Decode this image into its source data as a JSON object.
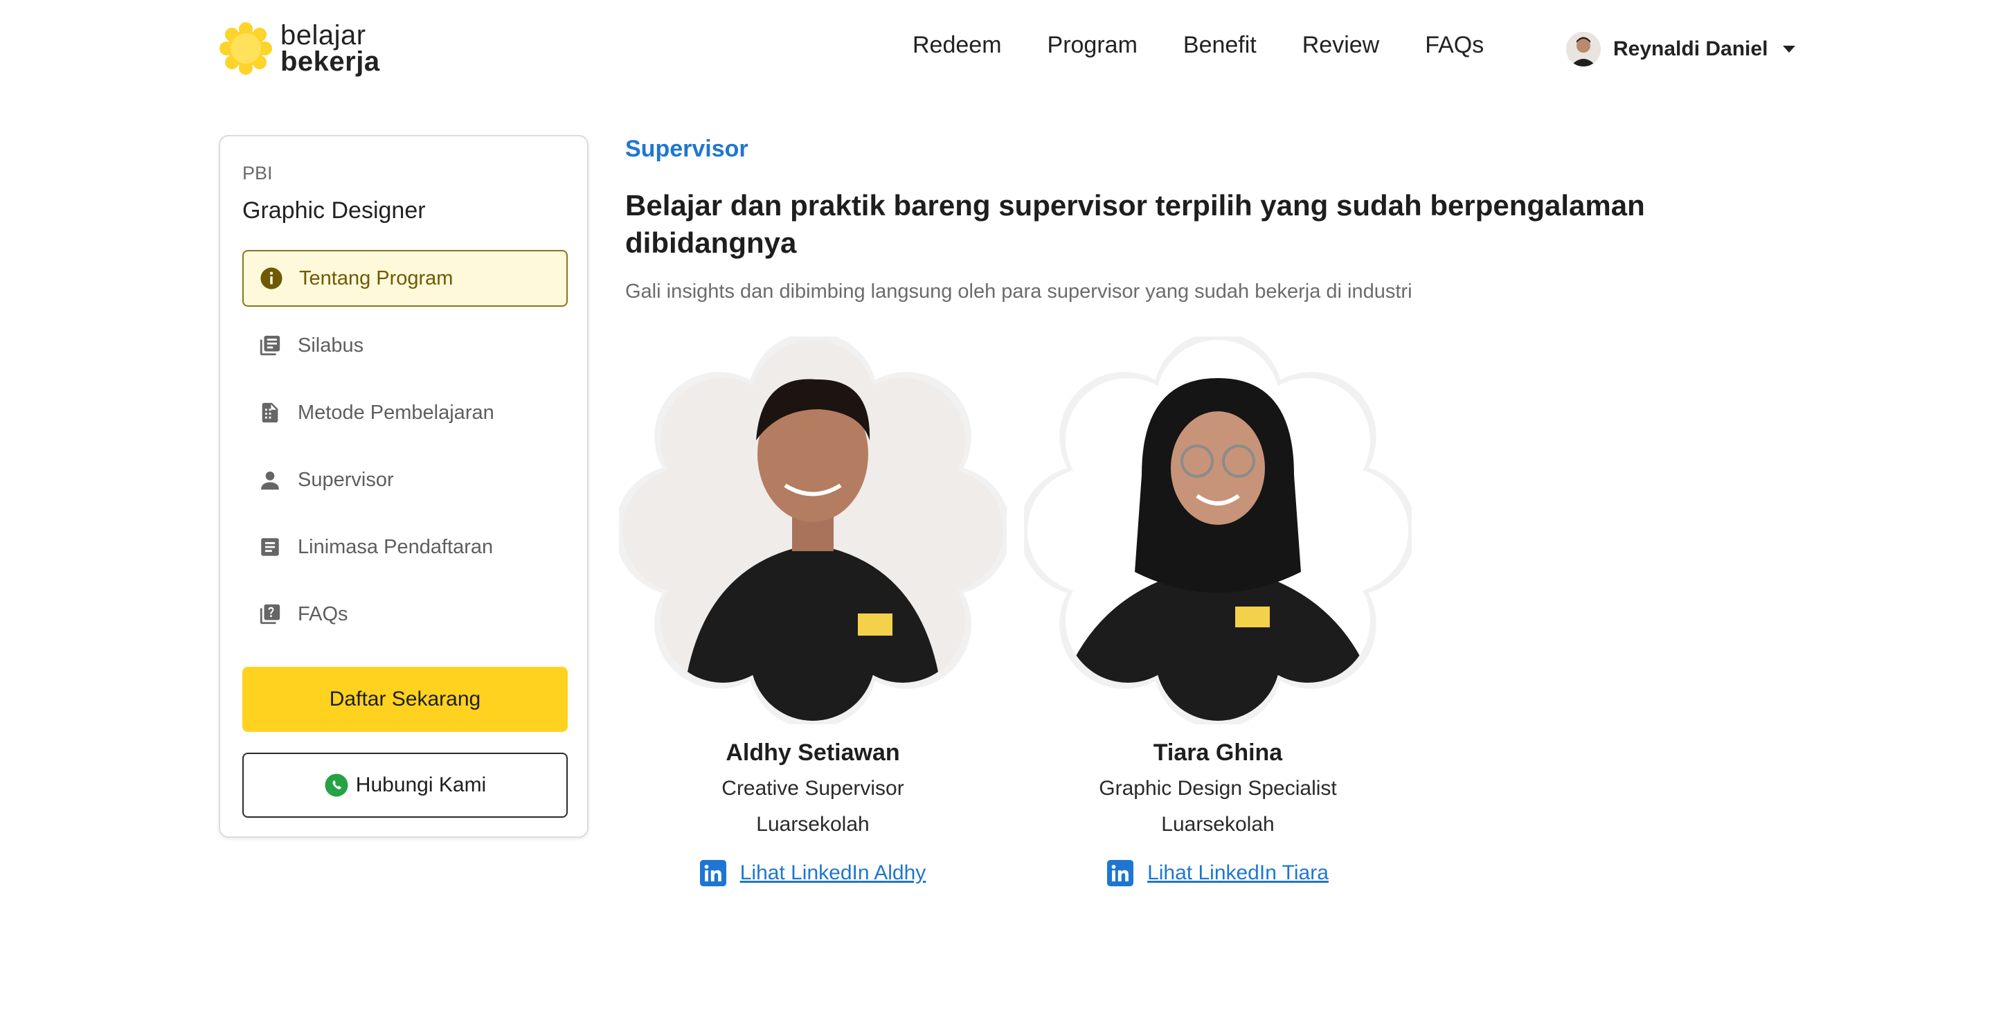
{
  "header": {
    "logo_line1": "belajar",
    "logo_line2": "bekerja",
    "nav": [
      "Redeem",
      "Program",
      "Benefit",
      "Review",
      "FAQs"
    ],
    "user_name": "Reynaldi Daniel"
  },
  "sidebar": {
    "category": "PBI",
    "title": "Graphic Designer",
    "items": [
      {
        "label": "Tentang Program",
        "icon": "info-icon",
        "active": true
      },
      {
        "label": "Silabus",
        "icon": "library-books-icon"
      },
      {
        "label": "Metode Pembelajaran",
        "icon": "document-icon"
      },
      {
        "label": "Supervisor",
        "icon": "person-icon"
      },
      {
        "label": "Linimasa Pendaftaran",
        "icon": "list-note-icon"
      },
      {
        "label": "FAQs",
        "icon": "help-icon"
      }
    ],
    "cta_primary": "Daftar Sekarang",
    "cta_secondary": "Hubungi Kami"
  },
  "main": {
    "section_label": "Supervisor",
    "headline": "Belajar dan praktik bareng supervisor terpilih yang sudah berpengalaman dibidangnya",
    "subtitle": "Gali insights dan dibimbing langsung oleh para supervisor yang sudah bekerja di industri",
    "supervisors": [
      {
        "name": "Aldhy Setiawan",
        "role": "Creative Supervisor",
        "company": "Luarsekolah",
        "link_label": "Lihat LinkedIn Aldhy"
      },
      {
        "name": "Tiara Ghina",
        "role": "Graphic Design Specialist",
        "company": "Luarsekolah",
        "link_label": "Lihat LinkedIn Tiara"
      }
    ]
  },
  "colors": {
    "accent_yellow": "#ffd21f",
    "link_blue": "#1e76d2",
    "active_bg": "#fff9db",
    "active_border": "#8c7417"
  }
}
